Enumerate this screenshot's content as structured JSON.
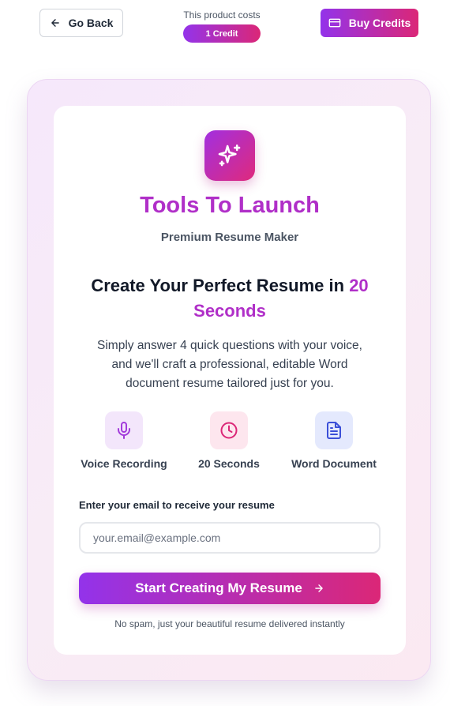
{
  "topbar": {
    "back_label": "Go Back",
    "cost_label": "This product costs",
    "cost_value": "1 Credit",
    "buy_label": "Buy Credits"
  },
  "brand": {
    "title": "Tools To Launch",
    "subtitle": "Premium Resume Maker"
  },
  "hero": {
    "headline_main": "Create Your Perfect Resume in ",
    "headline_accent": "20 Seconds",
    "description": "Simply answer 4 quick questions with your voice, and we'll craft a professional, editable Word document resume tailored just for you."
  },
  "features": [
    {
      "label": "Voice Recording",
      "icon": "microphone-icon",
      "color": "#a23bdb"
    },
    {
      "label": "20 Seconds",
      "icon": "clock-icon",
      "color": "#db2777"
    },
    {
      "label": "Word Document",
      "icon": "document-icon",
      "color": "#3b4fd8"
    }
  ],
  "form": {
    "email_label": "Enter your email to receive your resume",
    "email_placeholder": "your.email@example.com",
    "email_value": "",
    "submit_label": "Start Creating My Resume",
    "footnote": "No spam, just your beautiful resume delivered instantly"
  },
  "colors": {
    "gradient_start": "#9333ea",
    "gradient_end": "#db2777",
    "brand_accent": "#b02fc8"
  }
}
